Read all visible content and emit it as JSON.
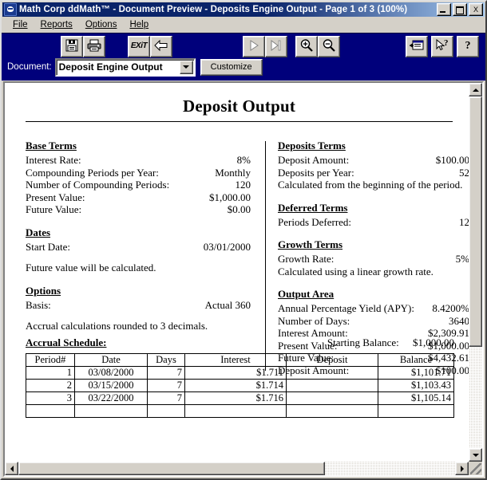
{
  "window": {
    "title": "Math Corp ddMath™ - Document Preview - Deposits Engine Output - Page  1 of  3  (100%)",
    "icon": "app-icon",
    "minimize_label": "_",
    "maximize_label": "□",
    "close_label": "X"
  },
  "menu": {
    "items": [
      {
        "label": "File",
        "accel": "F"
      },
      {
        "label": "Reports",
        "accel": "R"
      },
      {
        "label": "Options",
        "accel": "O"
      },
      {
        "label": "Help",
        "accel": "H"
      }
    ]
  },
  "toolbar": {
    "buttons": [
      {
        "name": "save-button",
        "icon": "floppy-disk-icon",
        "label": ""
      },
      {
        "name": "print-button",
        "icon": "printer-icon",
        "label": ""
      },
      {
        "name": "exit-button",
        "icon": "exit-icon",
        "label": "EXiT"
      },
      {
        "name": "previous-page-button",
        "icon": "arrow-left-icon",
        "label": ""
      },
      {
        "name": "next-page-button",
        "icon": "play-triangle-icon",
        "label": ""
      },
      {
        "name": "last-page-button",
        "icon": "skip-to-end-icon",
        "label": ""
      },
      {
        "name": "zoom-in-button",
        "icon": "magnifier-plus-icon",
        "label": ""
      },
      {
        "name": "zoom-out-button",
        "icon": "magnifier-minus-icon",
        "label": ""
      },
      {
        "name": "form-view-button",
        "icon": "form-window-icon",
        "label": ""
      },
      {
        "name": "context-help-button",
        "icon": "arrow-question-icon",
        "label": ""
      },
      {
        "name": "help-button",
        "icon": "question-mark-icon",
        "label": "?"
      }
    ],
    "document_label": "Document:",
    "document_value": "Deposit Engine Output",
    "customize_label": "Customize"
  },
  "document": {
    "title": "Deposit Output",
    "left_column": {
      "base_terms": {
        "heading": "Base Terms",
        "rows": [
          {
            "label": "Interest Rate:",
            "value": "8%"
          },
          {
            "label": "Compounding Periods per Year:",
            "value": "Monthly"
          },
          {
            "label": "Number of Compounding Periods:",
            "value": "120"
          },
          {
            "label": "Present Value:",
            "value": "$1,000.00"
          },
          {
            "label": "Future Value:",
            "value": "$0.00"
          }
        ]
      },
      "dates": {
        "heading": "Dates",
        "rows": [
          {
            "label": "Start Date:",
            "value": "03/01/2000"
          }
        ],
        "note": "Future value will be calculated."
      },
      "options": {
        "heading": "Options",
        "rows": [
          {
            "label": "Basis:",
            "value": "Actual 360"
          }
        ],
        "note": "Accrual calculations rounded to 3 decimals."
      }
    },
    "right_column": {
      "deposits_terms": {
        "heading": "Deposits Terms",
        "rows": [
          {
            "label": "Deposit Amount:",
            "value": "$100.00"
          },
          {
            "label": "Deposits per Year:",
            "value": "52"
          }
        ],
        "note": "Calculated from the beginning of the period."
      },
      "deferred_terms": {
        "heading": "Deferred Terms",
        "rows": [
          {
            "label": "Periods Deferred:",
            "value": "12"
          }
        ]
      },
      "growth_terms": {
        "heading": "Growth Terms",
        "rows": [
          {
            "label": "Growth Rate:",
            "value": "5%"
          }
        ],
        "note": "Calculated using a linear growth rate."
      },
      "output_area": {
        "heading": "Output Area",
        "rows": [
          {
            "label": "Annual Percentage Yield (APY):",
            "value": "8.4200%"
          },
          {
            "label": "Number of Days:",
            "value": "3640"
          },
          {
            "label": "Interest Amount:",
            "value": "$2,309.91"
          },
          {
            "label": "Present Value:",
            "value": "$1,000.00"
          },
          {
            "label": "Future Value:",
            "value": "$4,432.61"
          },
          {
            "label": "Deposit Amount:",
            "value": "$100.00"
          }
        ]
      }
    },
    "accrual_schedule": {
      "title": "Accrual Schedule:",
      "starting_balance_label": "Starting Balance:",
      "starting_balance_value": "$1,000.00",
      "columns": [
        "Period#",
        "Date",
        "Days",
        "Interest",
        "Deposit",
        "Balance"
      ],
      "rows": [
        {
          "period": "1",
          "date": "03/08/2000",
          "days": "7",
          "interest": "$1.711",
          "deposit": "",
          "balance": "$1,101.71"
        },
        {
          "period": "2",
          "date": "03/15/2000",
          "days": "7",
          "interest": "$1.714",
          "deposit": "",
          "balance": "$1,103.43"
        },
        {
          "period": "3",
          "date": "03/22/2000",
          "days": "7",
          "interest": "$1.716",
          "deposit": "",
          "balance": "$1,105.14"
        }
      ]
    }
  },
  "scrollbars": {
    "vertical": {
      "up": "▲",
      "down": "▼"
    },
    "horizontal": {
      "left": "◄",
      "right": "►"
    }
  },
  "colors": {
    "titlebar": "#0a246a",
    "toolbar": "#00007b",
    "face": "#d4d0c8",
    "page": "#ffffff"
  }
}
